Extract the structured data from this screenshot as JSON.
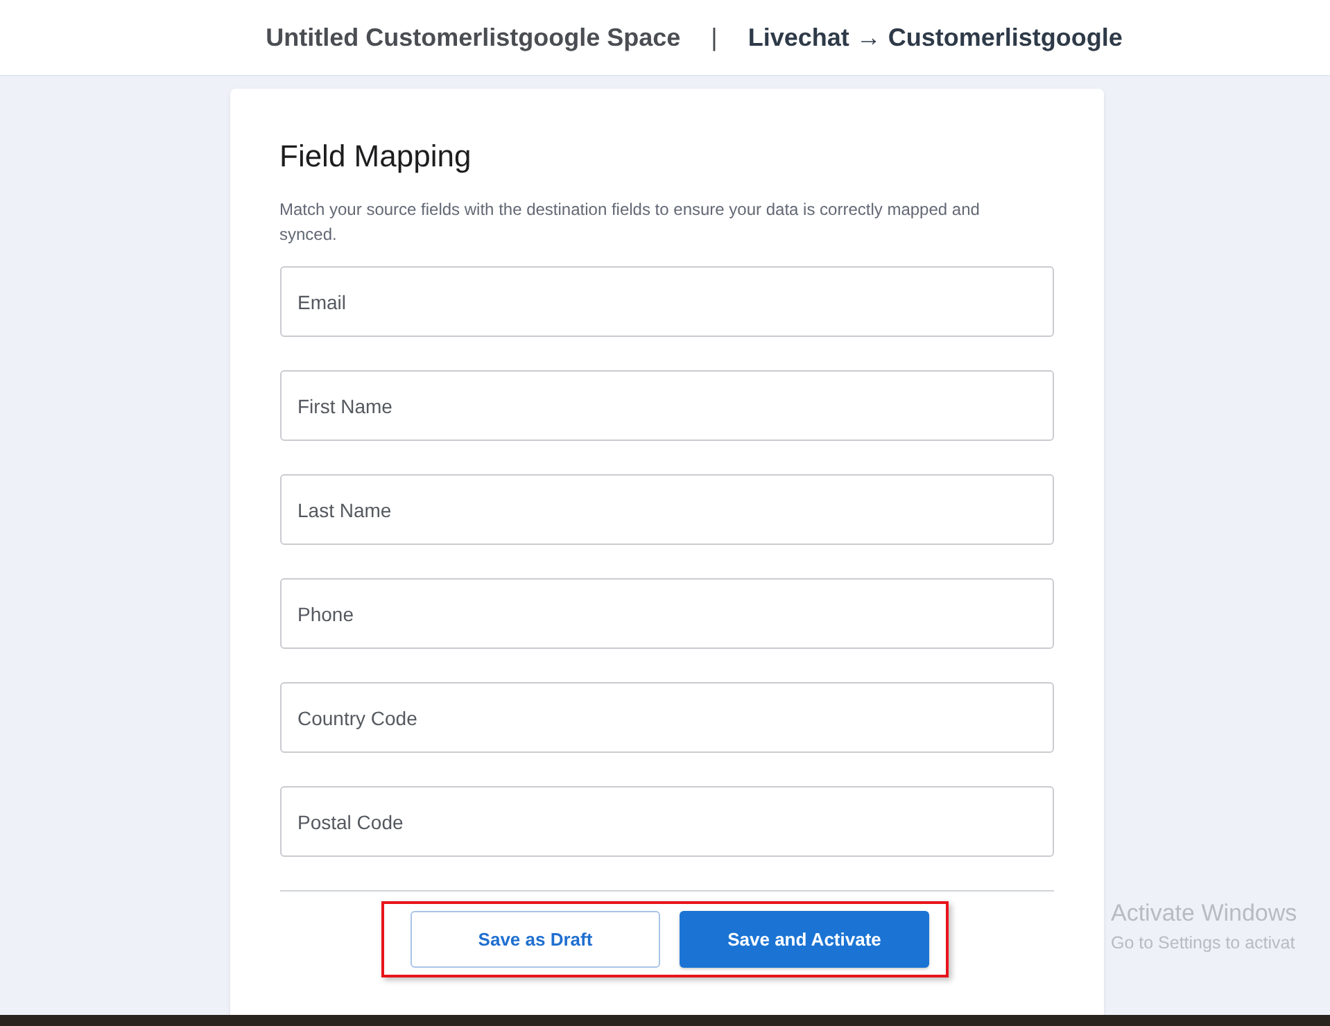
{
  "header": {
    "space_title": "Untitled Customerlistgoogle Space",
    "separator": "|",
    "flow": "Livechat → Customerlistgoogle"
  },
  "card": {
    "title": "Field Mapping",
    "description": "Match your source fields with the destination fields to ensure your data is correctly mapped and synced.",
    "fields": [
      {
        "placeholder": "Email"
      },
      {
        "placeholder": "First Name"
      },
      {
        "placeholder": "Last Name"
      },
      {
        "placeholder": "Phone"
      },
      {
        "placeholder": "Country Code"
      },
      {
        "placeholder": "Postal Code"
      }
    ],
    "buttons": [
      {
        "label": "Save as Draft",
        "kind": "secondary"
      },
      {
        "label": "Save and Activate",
        "kind": "primary"
      }
    ]
  },
  "os_notice": {
    "title": "Activate Windows",
    "subtitle": "Go to Settings to activat"
  }
}
